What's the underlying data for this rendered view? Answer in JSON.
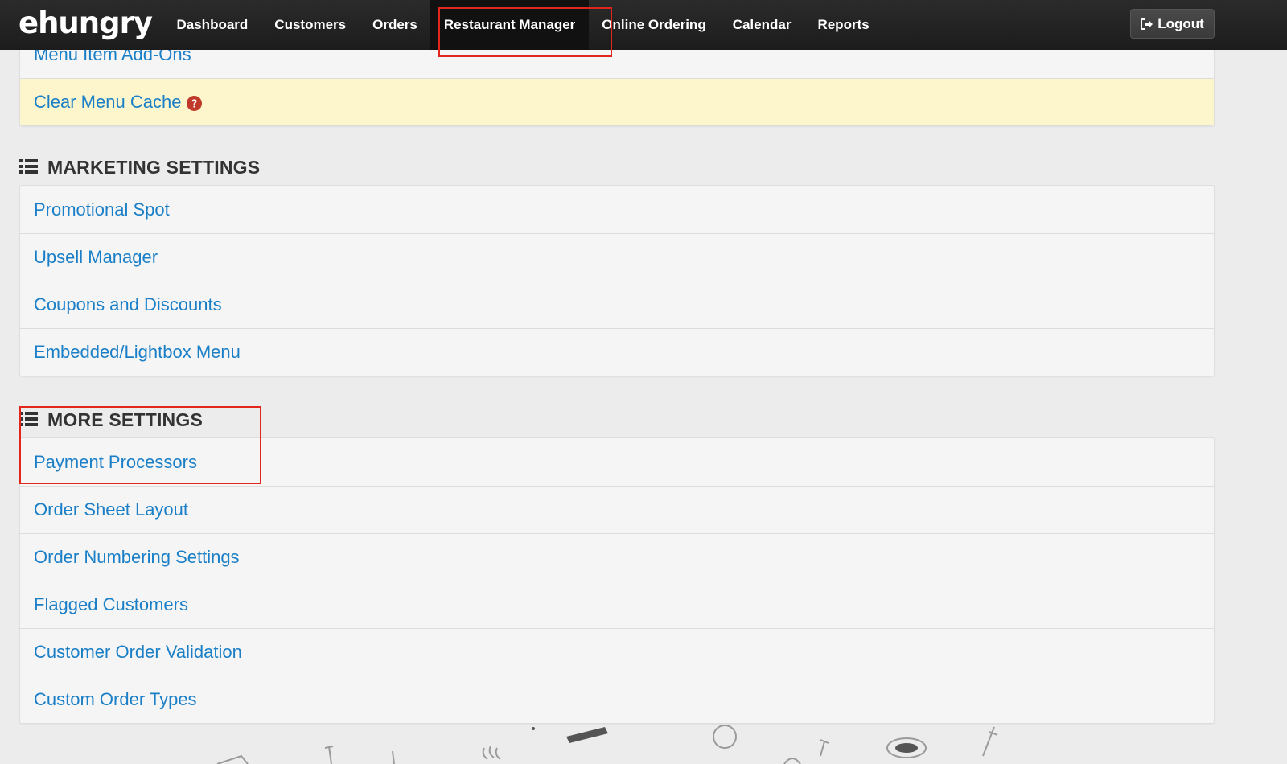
{
  "brand": {
    "logo_text": "ehungry"
  },
  "nav": {
    "items": [
      {
        "label": "Dashboard",
        "active": false
      },
      {
        "label": "Customers",
        "active": false
      },
      {
        "label": "Orders",
        "active": false
      },
      {
        "label": "Restaurant Manager",
        "active": true
      },
      {
        "label": "Online Ordering",
        "active": false
      },
      {
        "label": "Calendar",
        "active": false
      },
      {
        "label": "Reports",
        "active": false
      }
    ],
    "logout_label": "Logout"
  },
  "menu_panel": {
    "items": [
      {
        "label": "Menu Item Add-Ons"
      },
      {
        "label": "Clear Menu Cache",
        "highlighted": true,
        "help_icon": "question-circle-icon"
      }
    ]
  },
  "marketing_settings": {
    "title": "MARKETING SETTINGS",
    "items": [
      {
        "label": "Promotional Spot"
      },
      {
        "label": "Upsell Manager"
      },
      {
        "label": "Coupons and Discounts"
      },
      {
        "label": "Embedded/Lightbox Menu"
      }
    ]
  },
  "more_settings": {
    "title": "MORE SETTINGS",
    "items": [
      {
        "label": "Payment Processors"
      },
      {
        "label": "Order Sheet Layout"
      },
      {
        "label": "Order Numbering Settings"
      },
      {
        "label": "Flagged Customers"
      },
      {
        "label": "Customer Order Validation"
      },
      {
        "label": "Custom Order Types"
      }
    ]
  },
  "colors": {
    "link": "#1a7fc7",
    "navbar": "#222222",
    "highlight_row": "#fdf6cc",
    "annotation": "#e3261c",
    "help_icon": "#c0392b"
  }
}
